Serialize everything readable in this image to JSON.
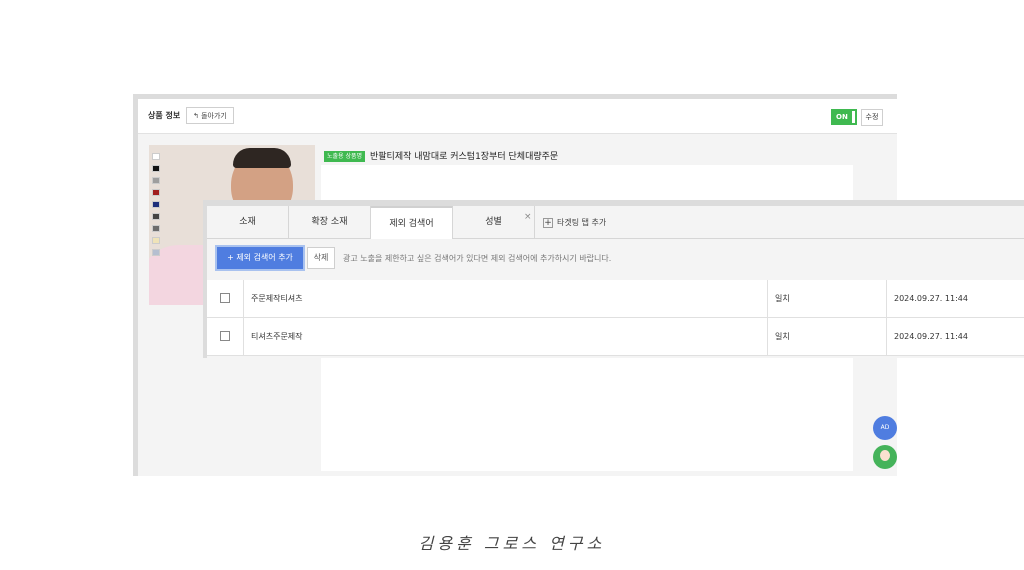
{
  "product_panel": {
    "title": "상품 정보",
    "back_label": "돌아가기",
    "toggle_label": "ON",
    "edit_label": "수정",
    "badge": "노출용 상품명",
    "product_name": "반팔티제작 내맘대로 커스텀1장부터 단체대량주문",
    "swatch_colors": [
      "#ffffff",
      "#111111",
      "#9e9e9e",
      "#a11d1d",
      "#1d2e7a",
      "#444444",
      "#6d6d6d",
      "#efe3b8",
      "#b5bfd0"
    ],
    "fab_ad_label": "AD"
  },
  "keyword_panel": {
    "tabs": [
      {
        "label": "소재",
        "active": false
      },
      {
        "label": "확장 소재",
        "active": false
      },
      {
        "label": "제외 검색어",
        "active": true
      },
      {
        "label": "성별",
        "active": false
      }
    ],
    "tab_close": "×",
    "add_tab_label": "타겟팅 탭 추가",
    "add_keyword_label": "제외 검색어 추가",
    "delete_label": "삭제",
    "hint": "광고 노출을 제한하고 싶은 검색어가 있다면 제외 검색어에 추가하시기 바랍니다.",
    "rows": [
      {
        "keyword": "주문제작티셔츠",
        "match": "일치",
        "date": "2024.09.27. 11:44"
      },
      {
        "keyword": "티셔츠주문제작",
        "match": "일치",
        "date": "2024.09.27. 11:44"
      }
    ]
  },
  "signature": "김용훈 그로스 연구소",
  "colors": {
    "accent_green": "#3fb950",
    "accent_blue": "#4f7de0"
  }
}
